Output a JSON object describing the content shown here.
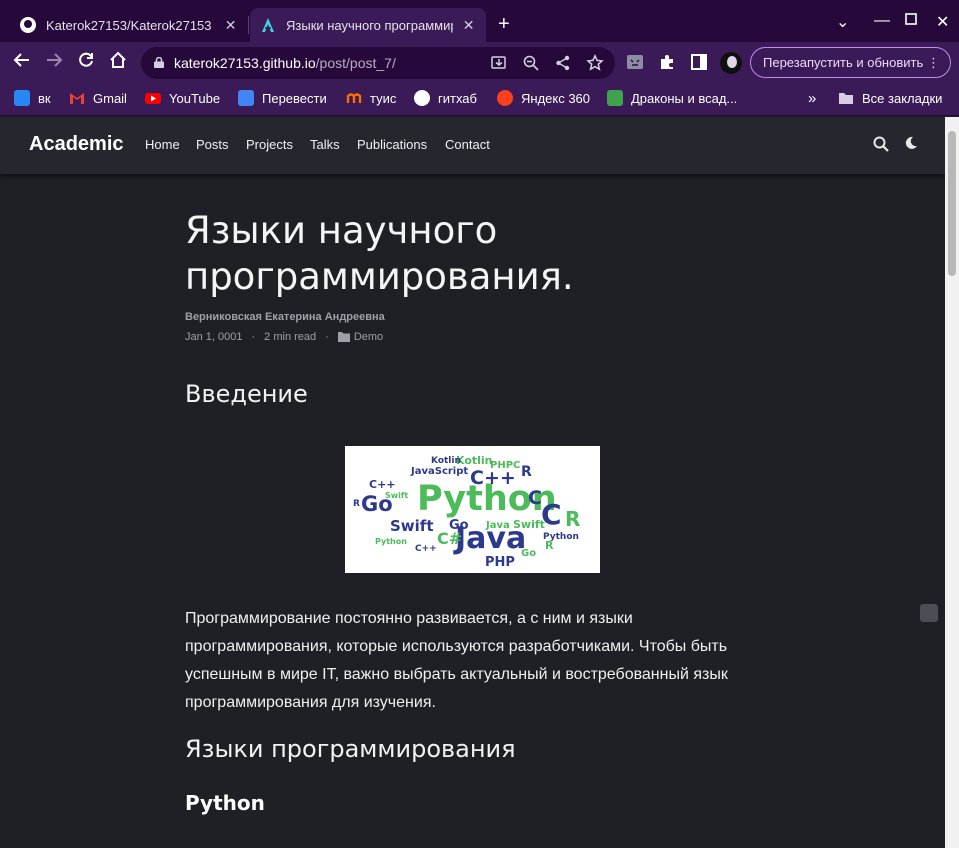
{
  "browser": {
    "tabs": [
      {
        "title": "Katerok27153/Katerok27153",
        "active": false,
        "favicon": "github-icon"
      },
      {
        "title": "Языки научного программирования",
        "active": true,
        "favicon": "academic-icon"
      }
    ],
    "new_tab_label": "+",
    "address": {
      "host": "katerok27153.github.io",
      "path": "/post/post_7/"
    },
    "relaunch_label": "Перезапустить и обновить",
    "bookmarks": [
      {
        "label": "вк",
        "icon": "vk-icon",
        "color": "#2787f5"
      },
      {
        "label": "Gmail",
        "icon": "gmail-icon",
        "color": "#ea4335"
      },
      {
        "label": "YouTube",
        "icon": "youtube-icon",
        "color": "#ff0000"
      },
      {
        "label": "Перевести",
        "icon": "translate-icon",
        "color": "#4285f4"
      },
      {
        "label": "туис",
        "icon": "tuis-icon",
        "color": "#ff6d00"
      },
      {
        "label": "гитхаб",
        "icon": "github-icon",
        "color": "#ffffff"
      },
      {
        "label": "Яндекс 360",
        "icon": "yandex360-icon",
        "color": "#fc3f1d"
      },
      {
        "label": "Драконы и всад...",
        "icon": "dragons-icon",
        "color": "#3fa34d"
      }
    ],
    "all_bookmarks_label": "Все закладки",
    "colors": {
      "frame": "#26093a",
      "toolbar": "#3a1b57",
      "relaunch_border": "#c58af0"
    }
  },
  "site": {
    "brand": "Academic",
    "nav": [
      "Home",
      "Posts",
      "Projects",
      "Talks",
      "Publications",
      "Contact"
    ]
  },
  "post": {
    "title": "Языки научного программирования.",
    "author": "Верниковская Екатерина Андреевна",
    "date": "Jan 1, 0001",
    "read_time": "2 min read",
    "category": "Demo",
    "meta_separator": "·",
    "heading_intro": "Введение",
    "image_words": [
      "Python",
      "Java",
      "C++",
      "Go",
      "C#",
      "C",
      "R",
      "Swift",
      "PHP",
      "Kotlin",
      "JavaScript"
    ],
    "paragraph": "Программирование постоянно развивается, а с ним и языки программирования, которые используются разработчиками. Чтобы быть успешным в мире IT, важно выбрать актуальный и востребованный язык программирования для изучения.",
    "heading_languages": "Языки программирования",
    "heading_python": "Python"
  }
}
